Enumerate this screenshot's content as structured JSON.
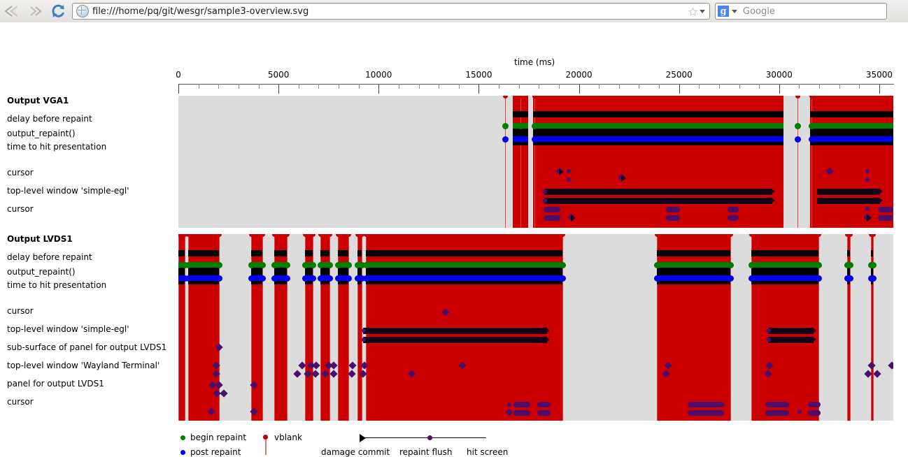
{
  "browser": {
    "back_label": "Back",
    "forward_label": "Forward",
    "reload_label": "Reload",
    "url": "file:///home/pq/git/wesgr/sample3-overview.svg",
    "bookmark_label": "Bookmark this page",
    "search_engine": "Google",
    "search_placeholder": "Google"
  },
  "chart_data": {
    "type": "timeline",
    "title": "",
    "xlabel": "time (ms)",
    "xlim": [
      0,
      35700
    ],
    "xticks": [
      0,
      5000,
      10000,
      15000,
      20000,
      25000,
      30000,
      35000
    ],
    "xtick_labels": [
      "0",
      "5000",
      "10000",
      "15000",
      "20000",
      "25000",
      "30000",
      "35000"
    ],
    "minor_tick_interval": 1000,
    "grid": false,
    "colors": {
      "background": "#dcdcdc",
      "activity": "#cc0000",
      "begin_repaint": "#007f00",
      "post_repaint": "#0000ee",
      "vblank": "#cc0000",
      "surface": "#4b0f6b",
      "bar": "#120016"
    },
    "sections": [
      {
        "name": "Output VGA1",
        "rows": [
          "delay before repaint",
          "output_repaint()",
          "time to hit presentation",
          "cursor",
          "top-level window 'simple-egl'",
          "cursor"
        ],
        "activity_intervals_ms": [
          [
            16230,
            17000
          ],
          [
            17450,
            28290
          ],
          [
            28870,
            35700
          ]
        ],
        "vblank_times_ms": [
          16030,
          16230,
          17450,
          28700,
          28870
        ]
      },
      {
        "name": "Output LVDS1",
        "rows": [
          "delay before repaint",
          "output_repaint()",
          "time to hit presentation",
          "cursor",
          "top-level window 'simple-egl'",
          "sub-surface of panel for output LVDS1",
          "top-level window 'Wayland Terminal'",
          "panel for output LVDS1",
          "cursor"
        ],
        "activity_intervals_ms": [
          [
            0,
            320
          ],
          [
            480,
            2020
          ],
          [
            3620,
            4180
          ],
          [
            4800,
            5400
          ],
          [
            6340,
            6700
          ],
          [
            7080,
            7560
          ],
          [
            7950,
            8500
          ],
          [
            8950,
            9160
          ],
          [
            9350,
            19170
          ],
          [
            23900,
            27550
          ],
          [
            28600,
            31950
          ],
          [
            33380,
            33520
          ],
          [
            34580,
            34680
          ]
        ]
      }
    ],
    "legend": [
      {
        "label": "begin repaint",
        "color": "#007f00",
        "marker": "dot"
      },
      {
        "label": "post repaint",
        "color": "#0000ee",
        "marker": "dot"
      },
      {
        "label": "vblank",
        "color": "#cc0000",
        "marker": "vline"
      },
      {
        "label": "damage commit",
        "marker": "triangle"
      },
      {
        "label": "repaint flush",
        "marker": "dot-mid"
      },
      {
        "label": "hit screen",
        "marker": "line-end"
      }
    ]
  }
}
